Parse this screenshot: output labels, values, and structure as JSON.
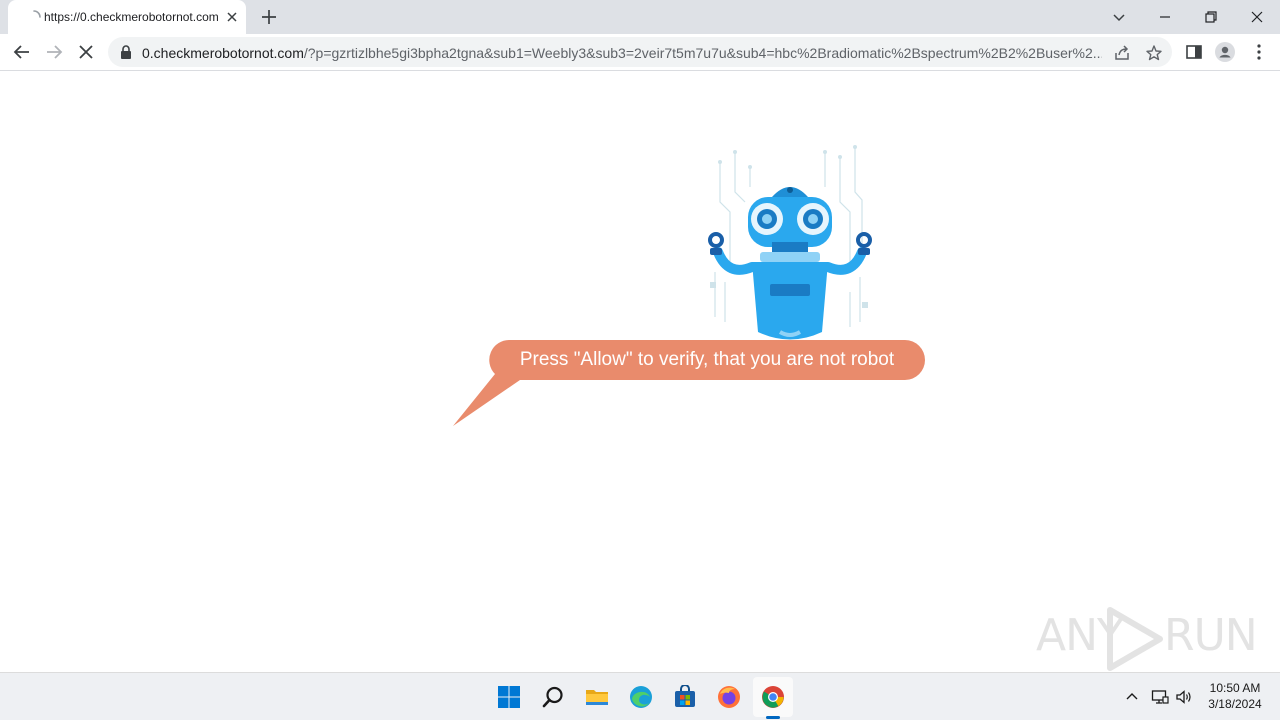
{
  "browser": {
    "tab": {
      "title": "https://0.checkmerobotornot.com",
      "favicon": "loading-favicon-icon"
    },
    "new_tab_icon": "plus-icon",
    "window_controls": [
      "chevron-down-icon",
      "minimize-icon",
      "restore-icon",
      "close-icon"
    ],
    "address_bar": {
      "host": "0.checkmerobotornot.com",
      "path": "/?p=gzrtizlbhe5gi3bpha2tgna&sub1=Weebly3&sub3=2veir7t5m7u7u&sub4=hbc%2Bradiomatic%2Bspectrum%2B2%2Buser%2..."
    }
  },
  "page": {
    "message": "Press \"Allow\" to verify, that you are not robot",
    "bubble_color": "#e98b6c",
    "robot_color": "#2aa8ee"
  },
  "watermark": {
    "left": "ANY",
    "right": "RUN"
  },
  "taskbar": {
    "apps": [
      "windows-start-icon",
      "search-icon",
      "file-explorer-icon",
      "edge-icon",
      "store-icon",
      "firefox-icon",
      "chrome-icon"
    ],
    "clock": {
      "time": "10:50 AM",
      "date": "3/18/2024"
    }
  }
}
